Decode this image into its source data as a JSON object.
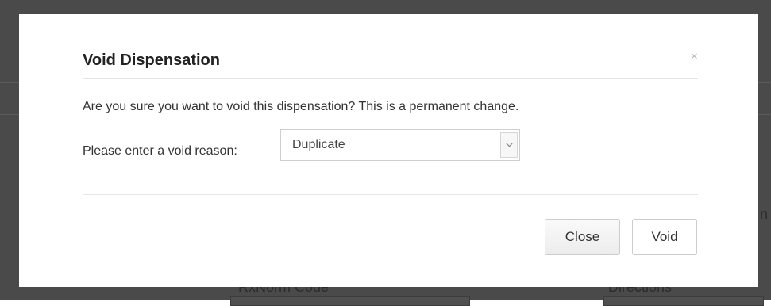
{
  "modal": {
    "title": "Void Dispensation",
    "close_symbol": "×",
    "confirm_message": "Are you sure you want to void this dispensation? This is a permanent change.",
    "reason_label": "Please enter a void reason:",
    "reason_select": {
      "selected": "Duplicate"
    },
    "buttons": {
      "close_label": "Close",
      "void_label": "Void"
    }
  },
  "background": {
    "labels": {
      "rxnorm_code": "RxNorm Code",
      "directions": "Directions",
      "edge_fragment": "n"
    }
  },
  "icons": {
    "dismiss": "close-icon",
    "select_arrow": "chevron-down-icon"
  }
}
